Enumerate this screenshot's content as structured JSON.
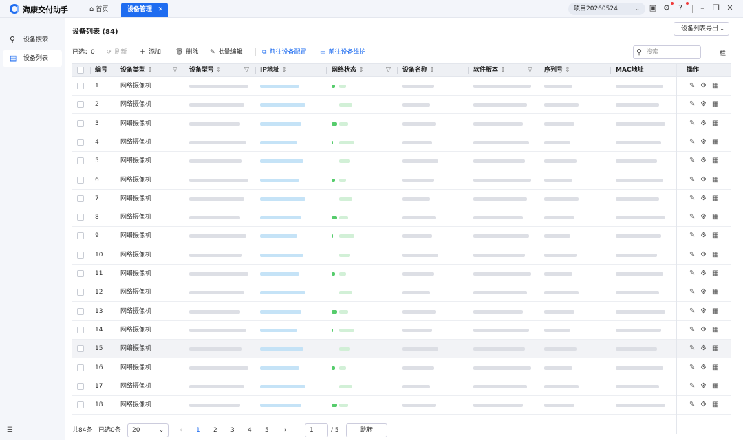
{
  "app": {
    "title": "海康交付助手"
  },
  "tabs": {
    "home": "首页",
    "active": "设备管理"
  },
  "project": "项目20260524",
  "sidebar": {
    "items": [
      {
        "label": "设备搜索"
      },
      {
        "label": "设备列表"
      }
    ]
  },
  "header": {
    "title": "设备列表 (84)",
    "export": "设备列表导出"
  },
  "toolbar": {
    "selected": "已选：0",
    "refresh": "刷新",
    "add": "添加",
    "delete": "删除",
    "batch_edit": "批量编辑",
    "config": "前往设备配置",
    "maintain": "前往设备维护",
    "search_placeholder": "搜索",
    "col_settings": "栏"
  },
  "columns": {
    "no": "编号",
    "type": "设备类型",
    "model": "设备型号",
    "ip": "IP地址",
    "status": "网络状态",
    "name": "设备名称",
    "sw": "软件版本",
    "sn": "序列号",
    "mac": "MAC地址",
    "ops": "操作"
  },
  "rows": [
    {
      "no": "1",
      "type": "网络摄像机"
    },
    {
      "no": "2",
      "type": "网络摄像机"
    },
    {
      "no": "3",
      "type": "网络摄像机"
    },
    {
      "no": "4",
      "type": "网络摄像机"
    },
    {
      "no": "5",
      "type": "网络摄像机"
    },
    {
      "no": "6",
      "type": "网络摄像机"
    },
    {
      "no": "7",
      "type": "网络摄像机"
    },
    {
      "no": "8",
      "type": "网络摄像机"
    },
    {
      "no": "9",
      "type": "网络摄像机"
    },
    {
      "no": "10",
      "type": "网络摄像机"
    },
    {
      "no": "11",
      "type": "网络摄像机"
    },
    {
      "no": "12",
      "type": "网络摄像机"
    },
    {
      "no": "13",
      "type": "网络摄像机"
    },
    {
      "no": "14",
      "type": "网络摄像机"
    },
    {
      "no": "15",
      "type": "网络摄像机"
    },
    {
      "no": "16",
      "type": "网络摄像机"
    },
    {
      "no": "17",
      "type": "网络摄像机"
    },
    {
      "no": "18",
      "type": "网络摄像机"
    }
  ],
  "highlight_row": "15",
  "pager": {
    "total": "共84条",
    "selected": "已选0条",
    "page_size": "20",
    "pages": [
      "1",
      "2",
      "3",
      "4",
      "5"
    ],
    "current": "1",
    "page_input": "1",
    "total_pages": "/ 5",
    "jump": "跳转"
  },
  "colors": {
    "accent": "#1e6cf0",
    "online": "#44c65c"
  },
  "icons": {
    "home": "home-icon",
    "refresh": "refresh-icon",
    "add": "plus-icon",
    "delete": "trash-icon",
    "edit": "pencil-icon",
    "config": "config-icon",
    "maintain": "monitor-icon",
    "search": "search-icon",
    "settings": "gear-icon",
    "qr": "qr-icon"
  }
}
